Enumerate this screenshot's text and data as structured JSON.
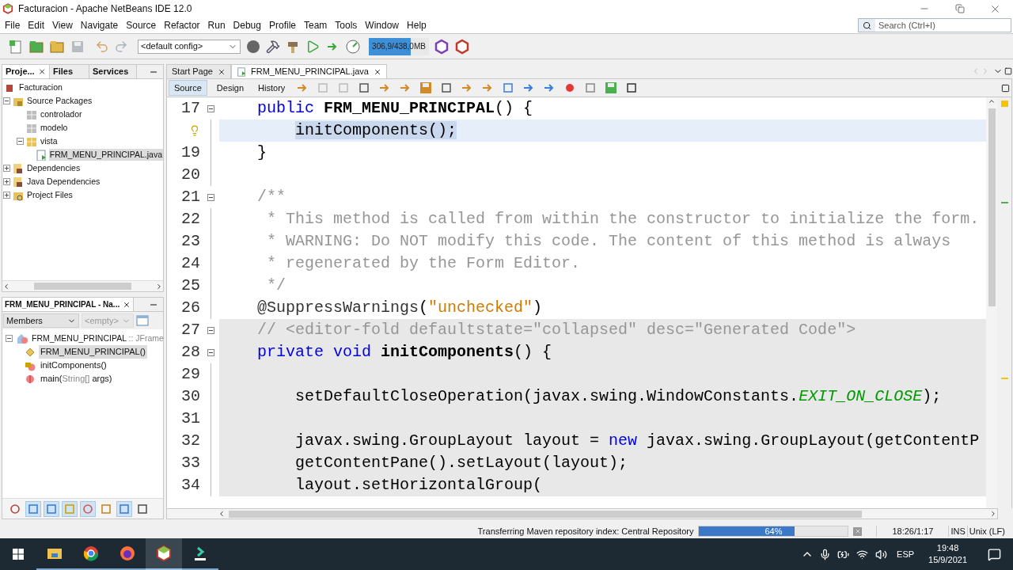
{
  "window": {
    "title": "Facturacion - Apache NetBeans IDE 12.0"
  },
  "menu": [
    "File",
    "Edit",
    "View",
    "Navigate",
    "Source",
    "Refactor",
    "Run",
    "Debug",
    "Profile",
    "Team",
    "Tools",
    "Window",
    "Help"
  ],
  "search": {
    "placeholder": "Search (Ctrl+I)"
  },
  "toolbar": {
    "config": "<default config>",
    "memory": {
      "reading": "306,9/438,0MB",
      "level": 0.7
    }
  },
  "project_tabs": [
    {
      "label": "Proje...",
      "selected": true
    },
    {
      "label": "Files",
      "selected": false
    },
    {
      "label": "Services",
      "selected": false
    }
  ],
  "project_tree": [
    {
      "label": "Facturacion",
      "kind": "project",
      "selected": false,
      "children": [
        {
          "label": "Source Packages",
          "kind": "source",
          "selected": false,
          "expanded": true,
          "children": [
            {
              "label": "controlador",
              "kind": "package",
              "selected": false
            },
            {
              "label": "modelo",
              "kind": "package",
              "selected": false
            },
            {
              "label": "vista",
              "kind": "package-open",
              "selected": false,
              "expanded": true,
              "children": [
                {
                  "label": "FRM_MENU_PRINCIPAL.java",
                  "kind": "java",
                  "selected": true
                }
              ]
            }
          ]
        },
        {
          "label": "Dependencies",
          "kind": "library",
          "selected": false,
          "expanded": false
        },
        {
          "label": "Java Dependencies",
          "kind": "library",
          "selected": false,
          "expanded": false
        },
        {
          "label": "Project Files",
          "kind": "files",
          "selected": false,
          "expanded": false
        }
      ]
    }
  ],
  "navigator": {
    "title": "FRM_MENU_PRINCIPAL - Na...",
    "filter": "Members",
    "second_filter": {
      "placeholder": "<empty>",
      "disabled": true
    },
    "root": {
      "label": "FRM_MENU_PRINCIPAL",
      "type": ":: JFrame",
      "expanded": true
    },
    "members": [
      {
        "label": "FRM_MENU_PRINCIPAL()",
        "kind": "constructor",
        "selected": true
      },
      {
        "label": "initComponents()",
        "kind": "private-method",
        "selected": false
      },
      {
        "label": "main(",
        "params": "String[]",
        "rest": " args)",
        "kind": "static-method",
        "selected": false
      }
    ],
    "tools": [
      {
        "kind": "group",
        "selected": false
      },
      {
        "kind": "square",
        "selected": true
      },
      {
        "kind": "bar",
        "selected": true
      },
      {
        "kind": "lock",
        "selected": true
      },
      {
        "kind": "shapes",
        "selected": true
      },
      {
        "kind": "inherited",
        "selected": false
      },
      {
        "kind": "sort-a",
        "selected": true
      },
      {
        "kind": "sort-b",
        "selected": false
      }
    ]
  },
  "editor_tabs": [
    {
      "label": "Start Page",
      "selected": false
    },
    {
      "label": "FRM_MENU_PRINCIPAL.java",
      "selected": true
    }
  ],
  "view_tabs": [
    {
      "label": "Source",
      "selected": true
    },
    {
      "label": "Design",
      "selected": false
    },
    {
      "label": "History",
      "selected": false
    }
  ],
  "code": [
    {
      "number": "17",
      "selected": false,
      "guarded": false,
      "fold": true,
      "hint": false,
      "tokens": [
        {
          "kind": "keyword",
          "text": "    public "
        },
        {
          "kind": "declaration",
          "text": "FRM_MENU_PRINCIPAL"
        },
        {
          "kind": "plain",
          "text": "() {"
        }
      ]
    },
    {
      "selected": true,
      "guarded": false,
      "fold": false,
      "hint": true,
      "tokens": [
        {
          "kind": "plain",
          "text": "        initComponents();"
        }
      ]
    },
    {
      "number": "19",
      "selected": false,
      "guarded": false,
      "fold": false,
      "hint": false,
      "tokens": [
        {
          "kind": "plain",
          "text": "    }"
        }
      ]
    },
    {
      "number": "20",
      "selected": false,
      "guarded": false,
      "fold": false,
      "hint": false
    },
    {
      "number": "21",
      "selected": false,
      "guarded": false,
      "fold": true,
      "hint": false,
      "tokens": [
        {
          "kind": "comment",
          "text": "    /**"
        }
      ]
    },
    {
      "number": "22",
      "selected": false,
      "guarded": false,
      "fold": false,
      "hint": false,
      "tokens": [
        {
          "kind": "comment",
          "text": "     * This method is called from within the constructor to initialize the form."
        }
      ]
    },
    {
      "number": "23",
      "selected": false,
      "guarded": false,
      "fold": false,
      "hint": false,
      "tokens": [
        {
          "kind": "comment",
          "text": "     * WARNING: Do NOT modify this code. The content of this method is always"
        }
      ]
    },
    {
      "number": "24",
      "selected": false,
      "guarded": false,
      "fold": false,
      "hint": false,
      "tokens": [
        {
          "kind": "comment",
          "text": "     * regenerated by the Form Editor."
        }
      ]
    },
    {
      "number": "25",
      "selected": false,
      "guarded": false,
      "fold": false,
      "hint": false,
      "tokens": [
        {
          "kind": "comment",
          "text": "     */"
        }
      ]
    },
    {
      "number": "26",
      "selected": false,
      "guarded": false,
      "fold": false,
      "hint": false,
      "tokens": [
        {
          "kind": "annotation",
          "text": "    @SuppressWarnings"
        },
        {
          "kind": "plain",
          "text": "("
        },
        {
          "kind": "string",
          "text": "\"unchecked\""
        },
        {
          "kind": "plain",
          "text": ")"
        }
      ]
    },
    {
      "number": "27",
      "selected": false,
      "guarded": true,
      "fold": true,
      "hint": false,
      "tokens": [
        {
          "kind": "comment",
          "text": "    // <editor-fold defaultstate=\"collapsed\" desc=\"Generated Code\">"
        }
      ]
    },
    {
      "number": "28",
      "selected": false,
      "guarded": true,
      "fold": true,
      "hint": false,
      "tokens": [
        {
          "kind": "keyword",
          "text": "    private void "
        },
        {
          "kind": "declaration",
          "text": "initComponents"
        },
        {
          "kind": "plain",
          "text": "() {"
        }
      ]
    },
    {
      "number": "29",
      "selected": false,
      "guarded": true,
      "fold": false,
      "hint": false
    },
    {
      "number": "30",
      "selected": false,
      "guarded": true,
      "fold": false,
      "hint": false,
      "tokens": [
        {
          "kind": "plain",
          "text": "        setDefaultCloseOperation(javax.swing.WindowConstants."
        },
        {
          "kind": "static",
          "text": "EXIT_ON_CLOSE"
        },
        {
          "kind": "plain",
          "text": ");"
        }
      ]
    },
    {
      "number": "31",
      "selected": false,
      "guarded": true,
      "fold": false,
      "hint": false
    },
    {
      "number": "32",
      "selected": false,
      "guarded": true,
      "fold": false,
      "hint": false,
      "tokens": [
        {
          "kind": "plain",
          "text": "        javax.swing.GroupLayout layout = "
        },
        {
          "kind": "keyword",
          "text": "new"
        },
        {
          "kind": "plain",
          "text": " javax.swing.GroupLayout(getContentP"
        }
      ]
    },
    {
      "number": "33",
      "selected": false,
      "guarded": true,
      "fold": false,
      "hint": false,
      "tokens": [
        {
          "kind": "plain",
          "text": "        getContentPane().setLayout(layout);"
        }
      ]
    },
    {
      "number": "34",
      "selected": false,
      "guarded": true,
      "fold": false,
      "hint": false,
      "tokens": [
        {
          "kind": "plain",
          "text": "        layout.setHorizontalGroup("
        }
      ]
    }
  ],
  "status_bar": {
    "message": "Transferring Maven repository index: Central Repository",
    "progress": {
      "reading": "64%",
      "level": 0.64
    },
    "position": "18:26/1:17",
    "mode": "INS",
    "line_endings": "Unix (LF)"
  },
  "taskbar": {
    "apps": [
      {
        "kind": "files",
        "selected": false
      },
      {
        "kind": "browser",
        "selected": false
      },
      {
        "kind": "firefox",
        "selected": false
      },
      {
        "kind": "netbeans",
        "selected": true
      },
      {
        "kind": "installer",
        "selected": false
      }
    ],
    "language": "ESP",
    "time": "19:48",
    "date": "15/9/2021"
  }
}
